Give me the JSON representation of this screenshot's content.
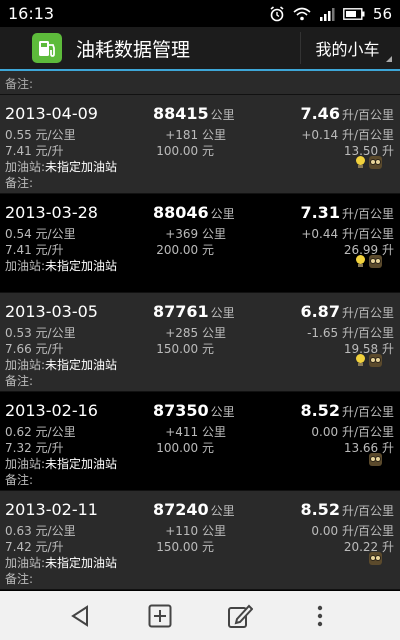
{
  "status_bar": {
    "time": "16:13",
    "battery_level": "56"
  },
  "action_bar": {
    "title": "油耗数据管理",
    "car_selector": "我的小车"
  },
  "top_remark": "备注:",
  "records": [
    {
      "date": "2013-04-09",
      "unit_price": "0.55 元/公里",
      "fuel_price": "7.41 元/升",
      "station_label": "加油站:",
      "station": "未指定加油站",
      "remark": "备注:",
      "odometer": "88415",
      "odometer_unit": "公里",
      "distance": "+181 公里",
      "cost": "100.00 元",
      "consumption": "7.46",
      "consumption_unit": "升/百公里",
      "change": "+0.14 升/百公里",
      "liters": "13.50 升",
      "icons": [
        "bulb-icon",
        "owl-icon"
      ],
      "style": "gray"
    },
    {
      "date": "2013-03-28",
      "unit_price": "0.54 元/公里",
      "fuel_price": "7.41 元/升",
      "station_label": "加油站:",
      "station": "未指定加油站",
      "remark": "",
      "odometer": "88046",
      "odometer_unit": "公里",
      "distance": "+369 公里",
      "cost": "200.00 元",
      "consumption": "7.31",
      "consumption_unit": "升/百公里",
      "change": "+0.44 升/百公里",
      "liters": "26.99 升",
      "icons": [
        "bulb-icon",
        "owl-icon"
      ],
      "style": "black"
    },
    {
      "date": "2013-03-05",
      "unit_price": "0.53 元/公里",
      "fuel_price": "7.66 元/升",
      "station_label": "加油站:",
      "station": "未指定加油站",
      "remark": "备注:",
      "odometer": "87761",
      "odometer_unit": "公里",
      "distance": "+285 公里",
      "cost": "150.00 元",
      "consumption": "6.87",
      "consumption_unit": "升/百公里",
      "change": "-1.65 升/百公里",
      "liters": "19.58 升",
      "icons": [
        "bulb-icon",
        "owl-icon"
      ],
      "style": "gray"
    },
    {
      "date": "2013-02-16",
      "unit_price": "0.62 元/公里",
      "fuel_price": "7.32 元/升",
      "station_label": "加油站:",
      "station": "未指定加油站",
      "remark": "备注:",
      "odometer": "87350",
      "odometer_unit": "公里",
      "distance": "+411 公里",
      "cost": "100.00 元",
      "consumption": "8.52",
      "consumption_unit": "升/百公里",
      "change": "0.00 升/百公里",
      "liters": "13.66 升",
      "icons": [
        "owl-icon"
      ],
      "style": "black"
    },
    {
      "date": "2013-02-11",
      "unit_price": "0.63 元/公里",
      "fuel_price": "7.42 元/升",
      "station_label": "加油站:",
      "station": "未指定加油站",
      "remark": "备注:",
      "odometer": "87240",
      "odometer_unit": "公里",
      "distance": "+110 公里",
      "cost": "150.00 元",
      "consumption": "8.52",
      "consumption_unit": "升/百公里",
      "change": "0.00 升/百公里",
      "liters": "20.22 升",
      "icons": [
        "owl-icon"
      ],
      "style": "gray"
    }
  ],
  "nav_bar": {
    "items": [
      "back-icon",
      "add-record-icon",
      "edit-icon",
      "overflow-menu-icon"
    ]
  },
  "colors": {
    "accent": "#3ea7d8",
    "app_icon_bg": "#5dbb3b",
    "row_gray": "#2a2a2a",
    "nav_bg": "#f1f1f1"
  }
}
